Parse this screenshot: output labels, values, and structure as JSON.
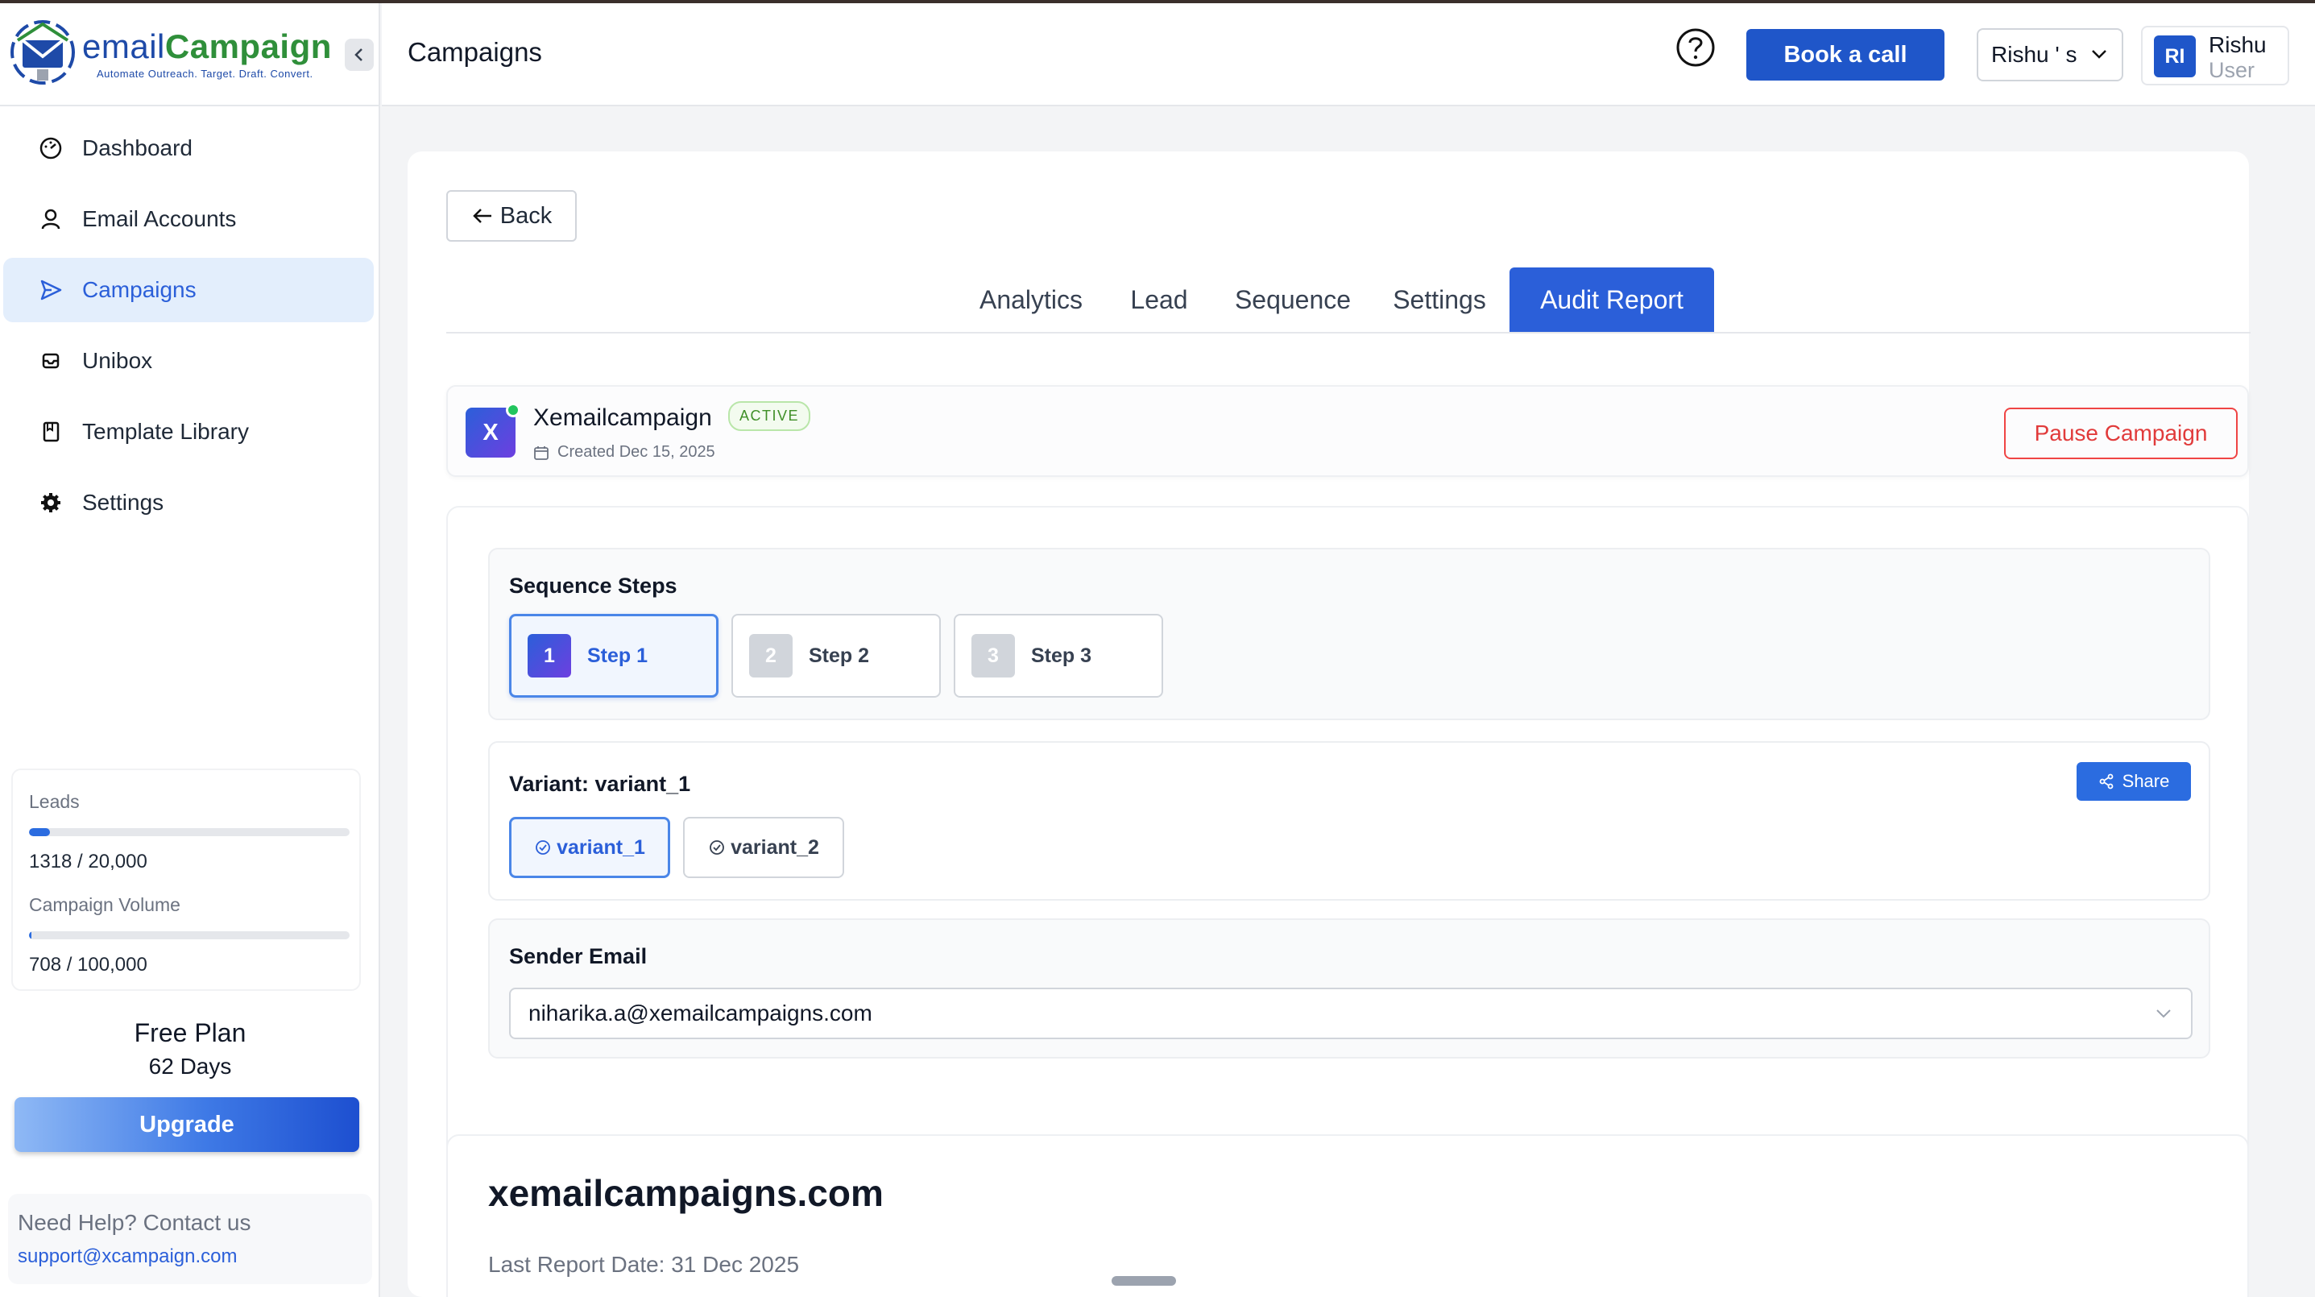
{
  "brand": {
    "name_part1": "email",
    "name_part2": "Campaign",
    "tagline": "Automate Outreach. Target. Draft. Convert."
  },
  "sidebar": {
    "items": [
      {
        "label": "Dashboard",
        "icon": "gauge-icon",
        "active": false
      },
      {
        "label": "Email Accounts",
        "icon": "user-icon",
        "active": false
      },
      {
        "label": "Campaigns",
        "icon": "send-icon",
        "active": true
      },
      {
        "label": "Unibox",
        "icon": "inbox-icon",
        "active": false
      },
      {
        "label": "Template Library",
        "icon": "bookmark-icon",
        "active": false
      },
      {
        "label": "Settings",
        "icon": "gear-icon",
        "active": false
      }
    ],
    "usage": {
      "leads_label": "Leads",
      "leads_value": "1318 / 20,000",
      "leads_fraction": 0.0659,
      "volume_label": "Campaign Volume",
      "volume_value": "708 / 100,000",
      "volume_fraction": 0.00708
    },
    "plan": {
      "name": "Free Plan",
      "days": "62 Days",
      "upgrade_label": "Upgrade"
    },
    "help": {
      "title": "Need Help? Contact us",
      "email": "support@xcampaign.com"
    }
  },
  "header": {
    "title": "Campaigns",
    "book_call_label": "Book a call",
    "workspace": "Rishu ' s",
    "user_initials": "RI",
    "user_name": "Rishu",
    "user_role": "User"
  },
  "main": {
    "back_label": "Back",
    "tabs": [
      {
        "label": "Analytics",
        "active": false
      },
      {
        "label": "Lead",
        "active": false
      },
      {
        "label": "Sequence",
        "active": false
      },
      {
        "label": "Settings",
        "active": false
      },
      {
        "label": "Audit Report",
        "active": true
      }
    ],
    "campaign": {
      "initial": "X",
      "name": "Xemailcampaign",
      "status": "ACTIVE",
      "created": "Created Dec 15, 2025",
      "pause_label": "Pause Campaign"
    },
    "sequence": {
      "title": "Sequence Steps",
      "steps": [
        {
          "num": "1",
          "label": "Step 1",
          "active": true
        },
        {
          "num": "2",
          "label": "Step 2",
          "active": false
        },
        {
          "num": "3",
          "label": "Step 3",
          "active": false
        }
      ]
    },
    "variant": {
      "title": "Variant: variant_1",
      "share_label": "Share",
      "options": [
        {
          "label": "variant_1",
          "active": true
        },
        {
          "label": "variant_2",
          "active": false
        }
      ]
    },
    "sender": {
      "title": "Sender Email",
      "value": "niharika.a@xemailcampaigns.com"
    },
    "report": {
      "domain": "xemailcampaigns.com",
      "date": "Last Report Date: 31 Dec 2025"
    }
  },
  "colors": {
    "primary": "#2b5fd9",
    "book_button": "#1f56c9",
    "danger": "#e13b3b",
    "success": "#22c55e"
  }
}
